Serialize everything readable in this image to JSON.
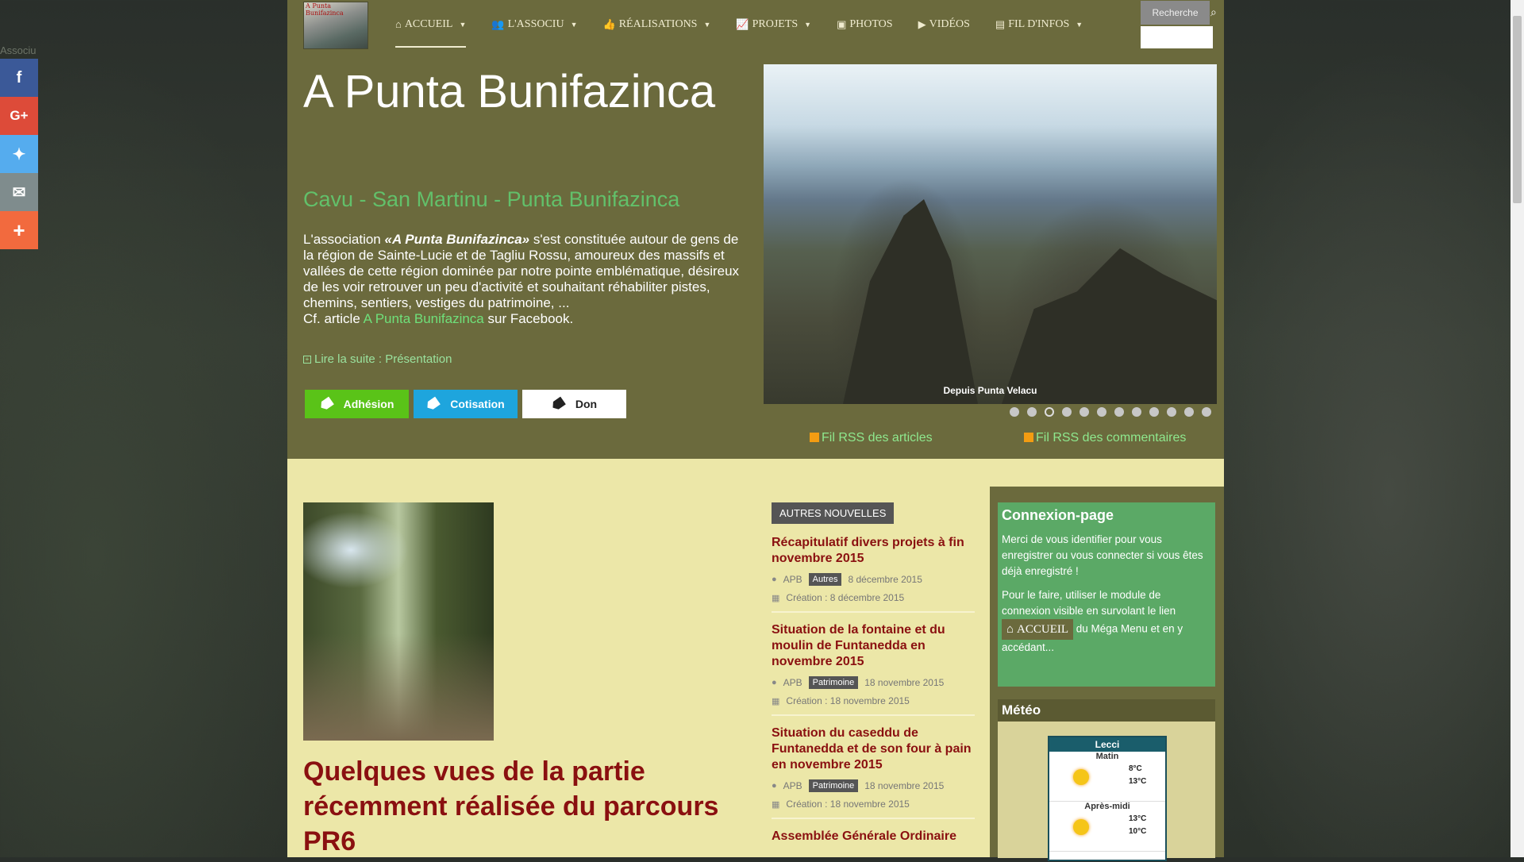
{
  "browser": {
    "page_tab_label": "Associu"
  },
  "social": [
    {
      "name": "facebook",
      "glyph": "f",
      "color": "#3b5998"
    },
    {
      "name": "google-plus",
      "glyph": "G+",
      "color": "#dd4b39"
    },
    {
      "name": "twitter",
      "glyph": "✦",
      "color": "#55acee"
    },
    {
      "name": "email",
      "glyph": "✉",
      "color": "#7f8c8d"
    },
    {
      "name": "more",
      "glyph": "+",
      "color": "#f26a3e"
    }
  ],
  "logo": {
    "text": "A Punta Bunifazinca"
  },
  "nav": [
    {
      "label": "ACCUEIL",
      "icon": "⌂",
      "caret": true
    },
    {
      "label": "L'ASSOCIU",
      "icon": "👥",
      "caret": true
    },
    {
      "label": "RÉALISATIONS",
      "icon": "👍",
      "caret": true
    },
    {
      "label": "PROJETS",
      "icon": "📈",
      "caret": true
    },
    {
      "label": "PHOTOS",
      "icon": "▣",
      "caret": false
    },
    {
      "label": "VIDÉOS",
      "icon": "▶",
      "caret": false
    },
    {
      "label": "FIL D'INFOS",
      "icon": "▤",
      "caret": true
    }
  ],
  "search": {
    "button_label": "Recherche",
    "placeholder": ""
  },
  "hero": {
    "title": "A Punta Bunifazinca",
    "subtitle": "Cavu - San Martinu - Punta Bunifazinca",
    "text_prefix": "L'association ",
    "text_em": "«A Punta Bunifazinca»",
    "text_body": " s'est constituée autour de gens de la région de Sainte-Lucie et de Tagliu Rossu, amoureux des massifs et vallées de cette région dominée par notre pointe emblématique, désireux de les voir retrouver un peu d'activité et souhaitant réhabiliter pistes, chemins, sentiers, vestiges du patrimoine, ...",
    "cf_prefix": "Cf. article ",
    "cf_link": "A Punta Bunifazinca",
    "cf_suffix": " sur Facebook.",
    "read_more": "Lire la suite : Présentation",
    "buttons": [
      "Adhésion",
      "Cotisation",
      "Don"
    ]
  },
  "slideshow": {
    "caption": "Depuis Punta Velacu",
    "dot_count": 12,
    "active_dot": 3
  },
  "rss": {
    "articles": "Fil RSS des articles",
    "comments": "Fil RSS des commentaires"
  },
  "featured": {
    "title": "Quelques vues de la partie récemment réalisée du parcours PR6"
  },
  "news": {
    "heading": "AUTRES NOUVELLES",
    "items": [
      {
        "title": "Récapitulatif divers projets à fin novembre 2015",
        "author": "APB",
        "category": "Autres",
        "date": "8 décembre 2015",
        "created": "Création : 8 décembre 2015"
      },
      {
        "title": "Situation de la fontaine et du moulin de Funtanedda en novembre 2015",
        "author": "APB",
        "category": "Patrimoine",
        "date": "18 novembre 2015",
        "created": "Création : 18 novembre 2015"
      },
      {
        "title": "Situation du caseddu de Funtanedda et de son four à pain en novembre 2015",
        "author": "APB",
        "category": "Patrimoine",
        "date": "18 novembre 2015",
        "created": "Création : 18 novembre 2015"
      },
      {
        "title": "Assemblée Générale Ordinaire"
      }
    ]
  },
  "connexion": {
    "title": "Connexion-page",
    "p1": "Merci de vous identifier pour vous enregistrer ou vous connecter si vous êtes déjà enregistré !",
    "p2_prefix": "Pour le faire, utiliser le module de connexion visible en survolant le lien",
    "accueil_label": "ACCUEIL",
    "p2_suffix": " du Méga Menu et en y accédant..."
  },
  "meteo": {
    "title": "Météo",
    "city": "Lecci",
    "morning": {
      "label": "Matin",
      "t1": "8°C",
      "t2": "13°C"
    },
    "afternoon": {
      "label": "Après-midi",
      "t1": "13°C",
      "t2": "10°C"
    }
  }
}
